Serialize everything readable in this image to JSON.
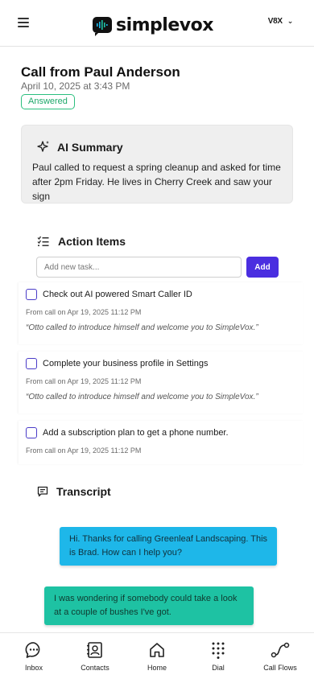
{
  "header": {
    "menu_icon": "hamburger-icon",
    "brand": "simplevox",
    "account_label": "V8X"
  },
  "call": {
    "title": "Call from Paul Anderson",
    "date": "April 10, 2025 at 3:43 PM",
    "status": "Answered",
    "status_color": "#2bbf7e"
  },
  "summary": {
    "heading": "AI Summary",
    "text": "Paul called to request a spring cleanup  and asked for time after 2pm Friday. He lives in Cherry Creek and saw your sign"
  },
  "actions": {
    "heading": "Action Items",
    "input_placeholder": "Add new task...",
    "add_label": "Add",
    "accent_color": "#4a2ee0",
    "tasks": [
      {
        "title": "Check out AI powered Smart Caller ID",
        "meta": "From call on Apr 19, 2025 11:12 PM",
        "quote": "“Otto called to introduce himself and welcome you to SimpleVox.”"
      },
      {
        "title": "Complete your business profile in Settings",
        "meta": "From call on Apr 19, 2025 11:12 PM",
        "quote": "“Otto called to introduce himself and welcome you to SimpleVox.”"
      },
      {
        "title": "Add a subscription plan to get a phone number.",
        "meta": "From call on Apr 19, 2025 11:12 PM"
      }
    ]
  },
  "transcript": {
    "heading": "Transcript",
    "messages": [
      {
        "speaker": "agent",
        "text": "Hi. Thanks for calling Greenleaf Landscaping. This is Brad. How can I help you?",
        "color": "#1eb7e9"
      },
      {
        "speaker": "caller",
        "text": "I was wondering if somebody could take a look at a couple of bushes I've got.",
        "color": "#1ec2a3"
      }
    ]
  },
  "nav": {
    "items": [
      {
        "label": "Inbox",
        "icon": "chat-bubble-icon"
      },
      {
        "label": "Contacts",
        "icon": "contacts-icon"
      },
      {
        "label": "Home",
        "icon": "home-icon"
      },
      {
        "label": "Dial",
        "icon": "dialpad-icon"
      },
      {
        "label": "Call Flows",
        "icon": "call-flows-icon"
      }
    ]
  }
}
